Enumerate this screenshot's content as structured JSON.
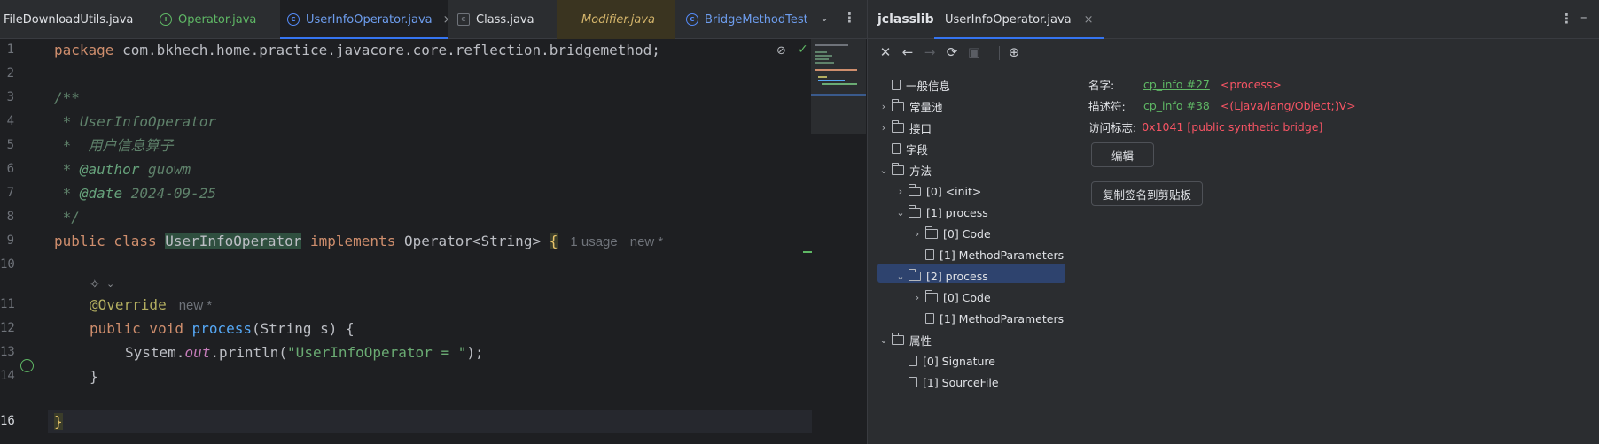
{
  "editor": {
    "tabs": [
      {
        "label": "FileDownloadUtils.java",
        "icon": "class-file-icon",
        "style": "plain"
      },
      {
        "label": "Operator.java",
        "icon": "interface-file-icon",
        "style": "green"
      },
      {
        "label": "UserInfoOperator.java",
        "icon": "class-file-icon",
        "style": "active"
      },
      {
        "label": "Class.java",
        "icon": "class-file-icon",
        "style": "plain"
      },
      {
        "label": "Modifier.java",
        "icon": "class-file-icon",
        "style": "italic"
      },
      {
        "label": "BridgeMethodTest.j",
        "icon": "class-file-icon",
        "style": "blue"
      }
    ],
    "close_glyph": "×",
    "line_numbers": [
      "1",
      "2",
      "3",
      "4",
      "5",
      "6",
      "7",
      "8",
      "9",
      "10",
      "11",
      "12",
      "13",
      "14",
      "16"
    ],
    "code": {
      "l1_kw": "package",
      "l1_pkg": " com.bkhech.home.practice.javacore.core.reflection.bridgemethod;",
      "l3": "/**",
      "l4": " * UserInfoOperator",
      "l5": " *  用户信息算子",
      "l6_star": " * ",
      "l6_tag": "@author",
      "l6_val": " guowm",
      "l7_star": " * ",
      "l7_tag": "@date",
      "l7_val": " 2024-09-25",
      "l8": " */",
      "l9_kw": "public class ",
      "l9_cls": "UserInfoOperator",
      "l9_impl": " implements ",
      "l9_iface": "Operator<String> ",
      "l9_brace": "{",
      "l9_hint1": "1 usage",
      "l9_hint2": "new *",
      "l11_ann": "@Override",
      "l11_hint": "new *",
      "l12_kw": "public void ",
      "l12_fn": "process",
      "l12_args": "(String s) {",
      "l13_sys": "System.",
      "l13_out": "out",
      "l13_call": ".println(",
      "l13_str": "\"UserInfoOperator = \"",
      "l13_end": ");",
      "l14": "}",
      "l16": "}"
    }
  },
  "jclasslib": {
    "title": "jclasslib",
    "tab_label": "UserInfoOperator.java",
    "tree": [
      {
        "label": "一般信息",
        "depth": 0,
        "expander": "",
        "icon": "file"
      },
      {
        "label": "常量池",
        "depth": 0,
        "expander": "›",
        "icon": "folder"
      },
      {
        "label": "接口",
        "depth": 0,
        "expander": "›",
        "icon": "folder"
      },
      {
        "label": "字段",
        "depth": 0,
        "expander": "",
        "icon": "file"
      },
      {
        "label": "方法",
        "depth": 0,
        "expander": "⌄",
        "icon": "folder"
      },
      {
        "label": "[0] <init>",
        "depth": 1,
        "expander": "›",
        "icon": "folder"
      },
      {
        "label": "[1] process",
        "depth": 1,
        "expander": "⌄",
        "icon": "folder"
      },
      {
        "label": "[0] Code",
        "depth": 2,
        "expander": "›",
        "icon": "folder"
      },
      {
        "label": "[1] MethodParameters",
        "depth": 2,
        "expander": "",
        "icon": "file"
      },
      {
        "label": "[2] process",
        "depth": 1,
        "expander": "⌄",
        "icon": "folder"
      },
      {
        "label": "[0] Code",
        "depth": 2,
        "expander": "›",
        "icon": "folder"
      },
      {
        "label": "[1] MethodParameters",
        "depth": 2,
        "expander": "",
        "icon": "file"
      },
      {
        "label": "属性",
        "depth": 0,
        "expander": "⌄",
        "icon": "folder"
      },
      {
        "label": "[0] Signature",
        "depth": 1,
        "expander": "",
        "icon": "file"
      },
      {
        "label": "[1] SourceFile",
        "depth": 1,
        "expander": "",
        "icon": "file"
      }
    ],
    "details": {
      "name_label": "名字:",
      "name_link": "cp_info #27",
      "name_value": "<process>",
      "desc_label": "描述符:",
      "desc_link": "cp_info #38",
      "desc_value": "<(Ljava/lang/Object;)V>",
      "access_label": "访问标志:",
      "access_value": "0x1041 [public synthetic bridge]",
      "edit_button": "编辑",
      "copy_button": "复制签名到剪贴板"
    }
  },
  "colors": {
    "accent": "#3574f0",
    "keyword": "#cf8e6d",
    "string": "#6aab73",
    "link": "#5fb865",
    "error_value": "#f75464"
  }
}
